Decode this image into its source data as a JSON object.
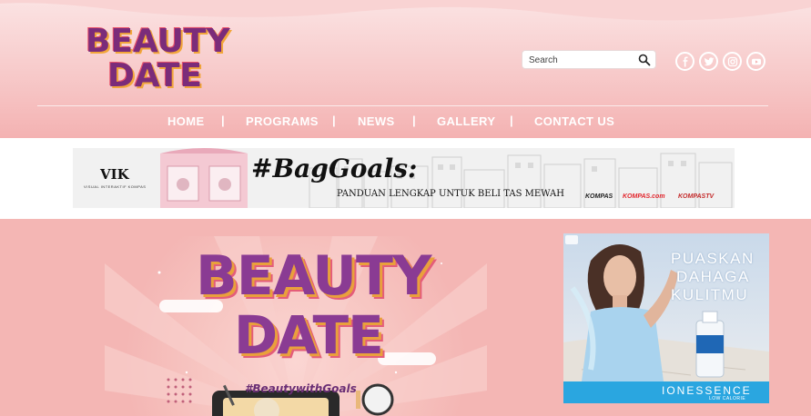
{
  "header": {
    "logo": {
      "line1": "BEAUTY",
      "line2": "DATE"
    },
    "search": {
      "placeholder": "Search"
    },
    "social": [
      "facebook-icon",
      "twitter-icon",
      "instagram-icon",
      "youtube-icon"
    ]
  },
  "nav": {
    "items": [
      "HOME",
      "PROGRAMS",
      "NEWS",
      "GALLERY",
      "CONTACT US"
    ],
    "separator": "|"
  },
  "ad_banner": {
    "brand": "VIK",
    "brand_sub": "VISUAL INTERAKTIF KOMPAS",
    "title": "#BagGoals:",
    "subtitle": "PANDUAN LENGKAP UNTUK BELI TAS MEWAH",
    "partners": [
      "KOMPAS",
      "KOMPAS.com",
      "KOMPASTV"
    ]
  },
  "hero": {
    "line1": "BEAUTY",
    "line2": "DATE",
    "hashtag": "#BeautywithGoals"
  },
  "side_ad": {
    "lines": [
      "PUASKAN",
      "DAHAGA",
      "KULITMU"
    ],
    "brand": "IONESSENCE",
    "brand_sub": "LOW CALORIE"
  },
  "colors": {
    "accent_purple": "#8a3b93",
    "header_pink": "#f4b2b2",
    "page_pink": "#f4b6b4",
    "ad_blue": "#2aa6e0"
  }
}
